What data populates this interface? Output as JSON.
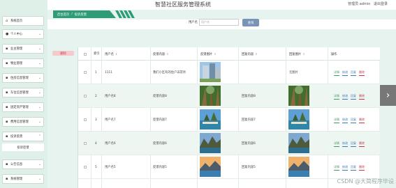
{
  "header": {
    "title": "智慧社区服务管理系统",
    "user_label": "管理员 admin",
    "logout": "退出登录"
  },
  "sidebar": {
    "items": [
      {
        "label": "系统首页",
        "icon": "home-icon"
      },
      {
        "label": "个人中心",
        "icon": "person-icon"
      },
      {
        "label": "业主管理",
        "icon": "user-group-icon"
      },
      {
        "label": "物业管理",
        "icon": "building-icon"
      },
      {
        "label": "住房信息管理",
        "icon": "house-icon"
      },
      {
        "label": "车位信息管理",
        "icon": "car-icon"
      },
      {
        "label": "固定资产管理",
        "icon": "box-icon"
      },
      {
        "label": "费用信息管理",
        "icon": "wallet-icon"
      },
      {
        "label": "投诉反馈",
        "icon": "chat-icon"
      },
      {
        "label": "投诉反馈",
        "icon": "sub-item"
      },
      {
        "label": "公告信息",
        "icon": "bell-icon"
      },
      {
        "label": "系统管理",
        "icon": "gear-icon"
      }
    ]
  },
  "breadcrumb": {
    "home": "后台首页",
    "current": "投诉反馈"
  },
  "search": {
    "label": "用户名",
    "placeholder": "用户名",
    "button": "查询"
  },
  "toolbar": {
    "delete": "删除"
  },
  "table": {
    "columns": [
      "索引",
      "用户名",
      "反馈内容",
      "反馈图片",
      "回复内容",
      "回复图片",
      "操作"
    ],
    "rows": [
      {
        "index": "1",
        "username": "1111",
        "content": "我们小区有的住户非常吵",
        "reply": "",
        "reply_img_text": "无图片"
      },
      {
        "index": "2",
        "username": "用户名8",
        "content": "反馈内容8",
        "reply": "回复内容8",
        "reply_img_text": ""
      },
      {
        "index": "3",
        "username": "用户名7",
        "content": "反馈内容7",
        "reply": "回复内容7",
        "reply_img_text": ""
      },
      {
        "index": "4",
        "username": "用户名6",
        "content": "反馈内容6",
        "reply": "回复内容6",
        "reply_img_text": ""
      },
      {
        "index": "5",
        "username": "用户名5",
        "content": "反馈内容5",
        "reply": "回复内容5",
        "reply_img_text": ""
      }
    ],
    "actions": [
      "详情",
      "修改",
      "回复",
      "删除"
    ]
  },
  "watermark": "CSDN @大简程序毕设"
}
